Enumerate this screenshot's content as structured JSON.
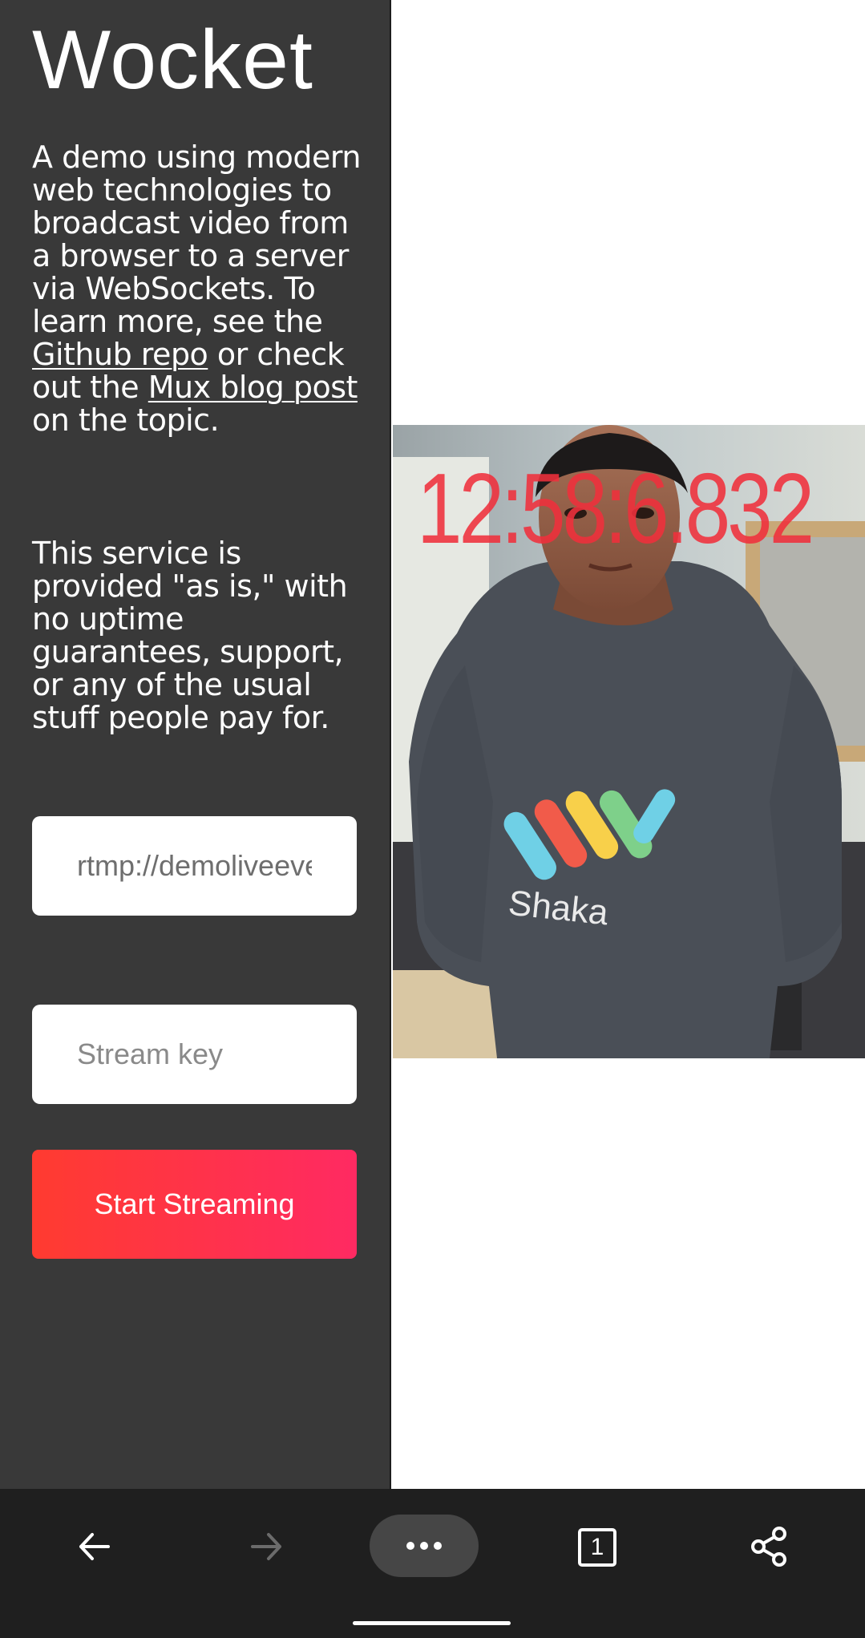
{
  "app": {
    "title": "Wocket"
  },
  "intro": {
    "text_before_repo": "A demo using modern web technologies to broadcast video from a browser to a server via WebSockets. To learn more, see the ",
    "repo_link": "Github repo",
    "text_between": " or check out the ",
    "blog_link": "Mux blog post",
    "text_after": " on the topic."
  },
  "disclaimer": "This service is provided \"as is,\" with no uptime guarantees, support, or any of the usual stuff people pay for.",
  "form": {
    "rtmp_value": "rtmp://demoliveeverywhere.com",
    "stream_key_placeholder": "Stream key",
    "start_button": "Start Streaming"
  },
  "video": {
    "timecode": "12:58:6.832",
    "shirt_text": "Shaka"
  },
  "toolbar": {
    "tab_count": "1",
    "icons": [
      "back-arrow-icon",
      "forward-arrow-icon",
      "more-dots-icon",
      "tabs-icon",
      "share-icon"
    ]
  },
  "colors": {
    "sidebar": "#393939",
    "button_start": "#ff3b30",
    "button_end": "#ff2a62",
    "timecode": "#f0303c"
  }
}
